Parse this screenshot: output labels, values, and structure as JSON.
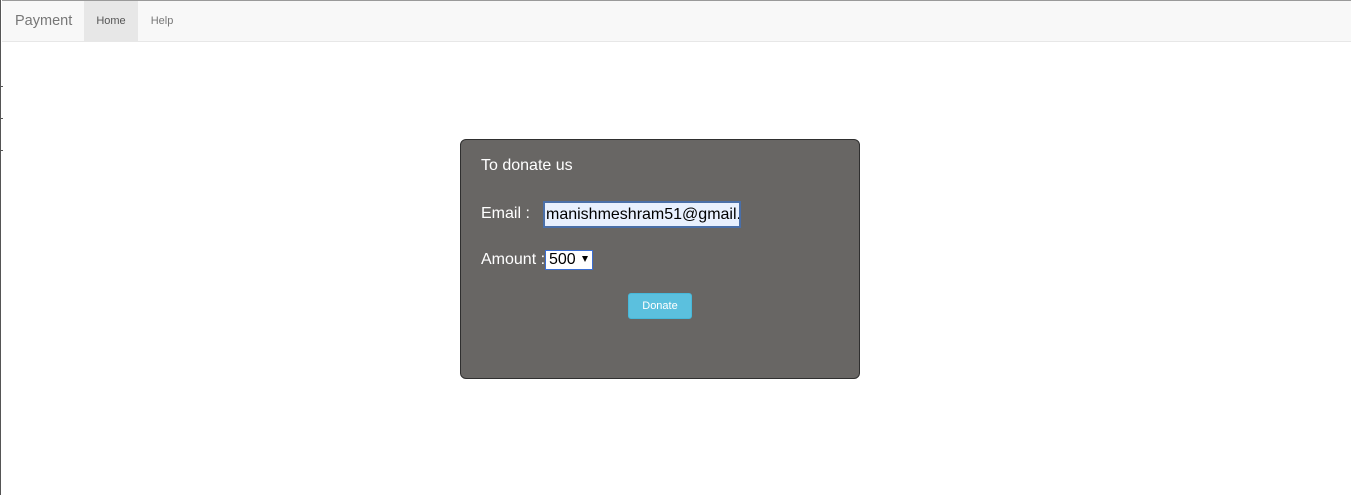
{
  "navbar": {
    "brand": "Payment",
    "items": [
      {
        "label": "Home",
        "active": true
      },
      {
        "label": "Help",
        "active": false
      }
    ]
  },
  "donation_form": {
    "title": "To donate us",
    "email_label": "Email :",
    "email_value": "manishmeshram51@gmail.",
    "amount_label": "Amount :",
    "amount_selected": "500",
    "donate_label": "Donate"
  },
  "colors": {
    "panel_background": "#686664",
    "button_background": "#5bc0de",
    "navbar_background": "#f8f8f8",
    "active_nav_background": "#e7e7e7"
  }
}
